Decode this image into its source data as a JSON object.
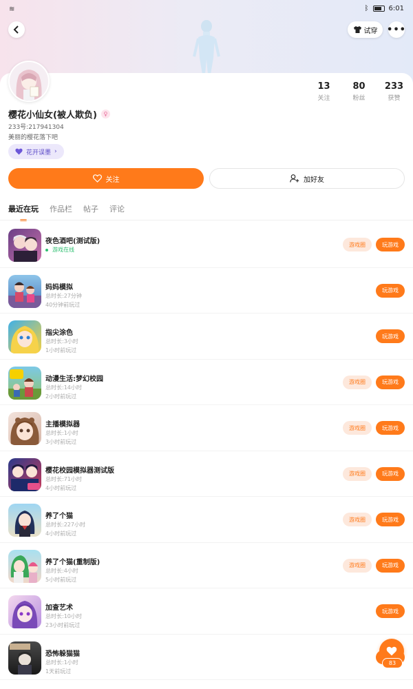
{
  "status_bar": {
    "time": "6:01"
  },
  "header": {
    "tryon_label": "试穿"
  },
  "profile": {
    "nickname": "樱花小仙女(被人欺负)",
    "gender_symbol": "♀",
    "uid": "233号:217941304",
    "bio": "美丽的樱花落下吧",
    "honor": "花开误墨",
    "stats": [
      {
        "value": "13",
        "label": "关注"
      },
      {
        "value": "80",
        "label": "粉丝"
      },
      {
        "value": "233",
        "label": "获赞"
      }
    ],
    "follow_label": "关注",
    "add_friend_label": "加好友"
  },
  "tabs": [
    {
      "label": "最近在玩",
      "active": true
    },
    {
      "label": "作品栏"
    },
    {
      "label": "帖子"
    },
    {
      "label": "评论"
    }
  ],
  "games": [
    {
      "name": "夜色酒吧(测试版)",
      "status": "游戏在线",
      "circle": "游戏圈",
      "play": "玩游戏"
    },
    {
      "name": "妈妈模拟",
      "duration": "总时长:27分钟",
      "last": "40分钟前玩过",
      "play": "玩游戏"
    },
    {
      "name": "指尖涂色",
      "duration": "总时长:3小时",
      "last": "1小时前玩过",
      "play": "玩游戏"
    },
    {
      "name": "动漫生活:梦幻校园",
      "duration": "总时长:14小时",
      "last": "2小时前玩过",
      "circle": "游戏圈",
      "play": "玩游戏"
    },
    {
      "name": "主播模拟器",
      "duration": "总时长:1小时",
      "last": "3小时前玩过",
      "circle": "游戏圈",
      "play": "玩游戏"
    },
    {
      "name": "樱花校园模拟器测试版",
      "duration": "总时长:71小时",
      "last": "4小时前玩过",
      "circle": "游戏圈",
      "play": "玩游戏"
    },
    {
      "name": "养了个猫",
      "duration": "总时长:227小时",
      "last": "4小时前玩过",
      "circle": "游戏圈",
      "play": "玩游戏"
    },
    {
      "name": "养了个猫(重制版)",
      "duration": "总时长:4小时",
      "last": "5小时前玩过",
      "circle": "游戏圈",
      "play": "玩游戏"
    },
    {
      "name": "加查艺术",
      "duration": "总时长:10小时",
      "last": "23小时前玩过",
      "play": "玩游戏"
    },
    {
      "name": "恐怖躲猫猫",
      "duration": "总时长:1小时",
      "last": "1天前玩过",
      "play": "玩游戏"
    }
  ],
  "fab": {
    "count": "83"
  },
  "colors": {
    "accent": "#ff7a1a",
    "online": "#2fbf71",
    "honor": "#5b4ac7"
  }
}
